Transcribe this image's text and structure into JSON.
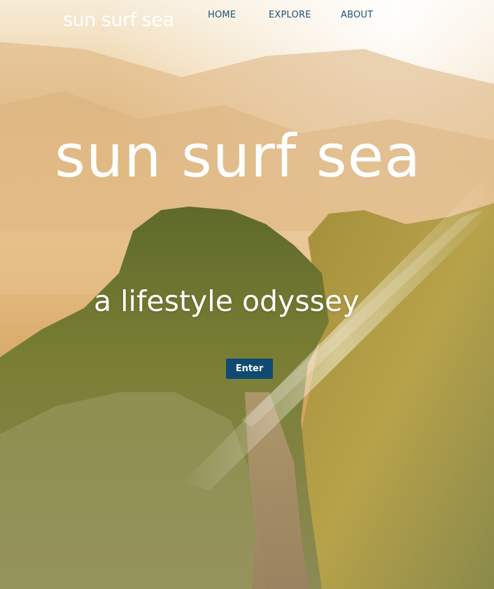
{
  "brand": {
    "logo_text": "sun surf sea"
  },
  "nav": {
    "items": [
      {
        "label": "HOME"
      },
      {
        "label": "EXPLORE"
      },
      {
        "label": "ABOUT"
      }
    ]
  },
  "hero": {
    "title": "sun surf sea",
    "tagline": "a lifestyle odyssey",
    "enter_label": "Enter"
  },
  "colors": {
    "nav_text": "#1e4f73",
    "button_bg": "#104a72",
    "headline_text": "#ffffff"
  }
}
